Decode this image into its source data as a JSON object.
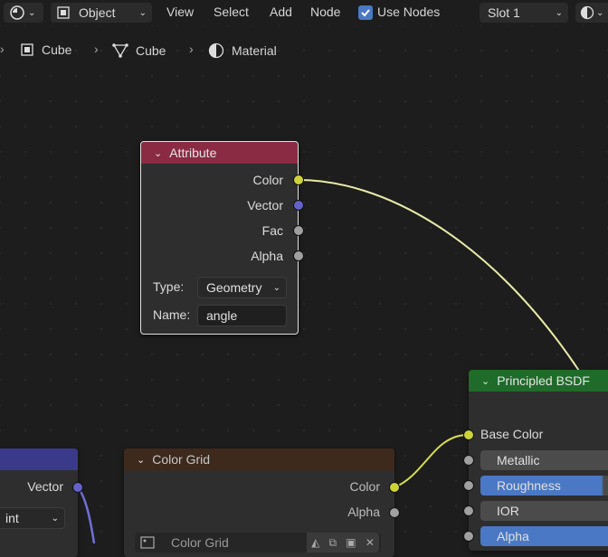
{
  "header": {
    "mode_label": "Object",
    "menu": [
      "View",
      "Select",
      "Add",
      "Node"
    ],
    "use_nodes_label": "Use Nodes",
    "use_nodes_checked": true,
    "slot_label": "Slot 1"
  },
  "breadcrumb": [
    "Cube",
    "Cube",
    "Material"
  ],
  "attribute_node": {
    "title": "Attribute",
    "outputs": [
      "Color",
      "Vector",
      "Fac",
      "Alpha"
    ],
    "type_label": "Type:",
    "type_value": "Geometry",
    "name_label": "Name:",
    "name_value": "angle"
  },
  "bsdf_node": {
    "title": "Principled BSDF",
    "inputs": [
      "Base Color",
      "Metallic",
      "Roughness",
      "IOR",
      "Alpha"
    ]
  },
  "color_grid_node": {
    "title": "Color Grid",
    "outputs": [
      "Color",
      "Alpha"
    ],
    "image_label": "Color Grid"
  },
  "left_node": {
    "output": "Vector",
    "dropdown_value": "int"
  },
  "colors": {
    "attribute_header": "#8a2a43",
    "bsdf_header": "#1f6b2a",
    "color_grid_header": "#3d2a1d",
    "left_header": "#3b3a8a",
    "link_yellow": "#e8eaa8",
    "link_purple": "#6f6fd6",
    "accent_blue": "#4a78c4"
  }
}
